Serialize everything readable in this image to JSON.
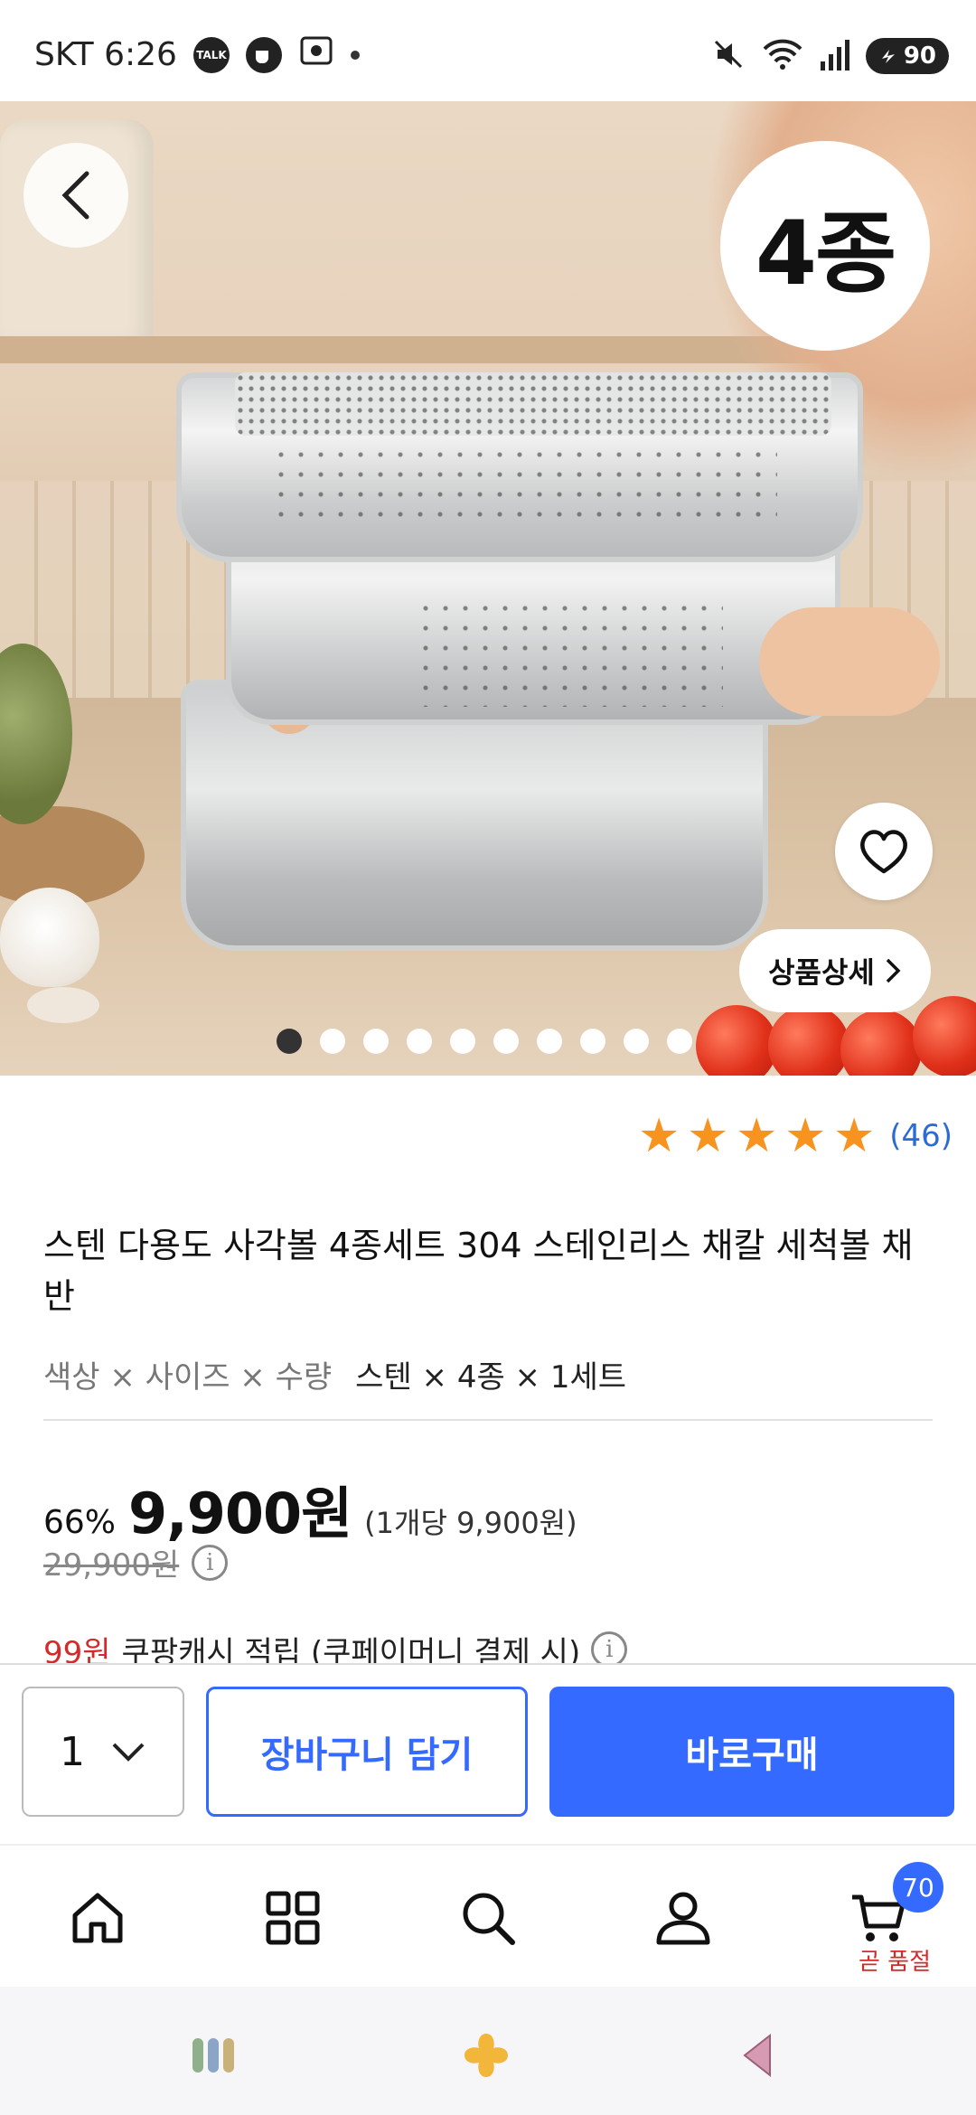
{
  "status_bar": {
    "carrier_time": "SKT 6:26",
    "talk_label": "TALK",
    "battery": "90"
  },
  "hero": {
    "badge": "4종",
    "detail_button": "상품상세",
    "image_count": 10,
    "active_index": 0
  },
  "product": {
    "rating_count": "(46)",
    "stars": 5,
    "title": "스텐 다용도 사각볼 4종세트 304 스테인리스 채칼 세척볼 채반",
    "option_label": "색상 × 사이즈 × 수량",
    "option_value": "스텐 × 4종 × 1세트",
    "discount": "66%",
    "price": "9,900원",
    "unit_price": "(1개당 9,900원)",
    "original_price": "29,900원",
    "cash_amount": "99원",
    "cash_text": "쿠팡캐시 적립 (쿠페이머니 결제 시)"
  },
  "purchase": {
    "quantity": "1",
    "cart_label": "장바구니 담기",
    "buy_label": "바로구매"
  },
  "nav": {
    "cart_badge": "70",
    "cart_note": "곧 품절"
  },
  "colors": {
    "accent": "#346aff",
    "star": "#f7931e",
    "sale": "#d62a2a"
  }
}
